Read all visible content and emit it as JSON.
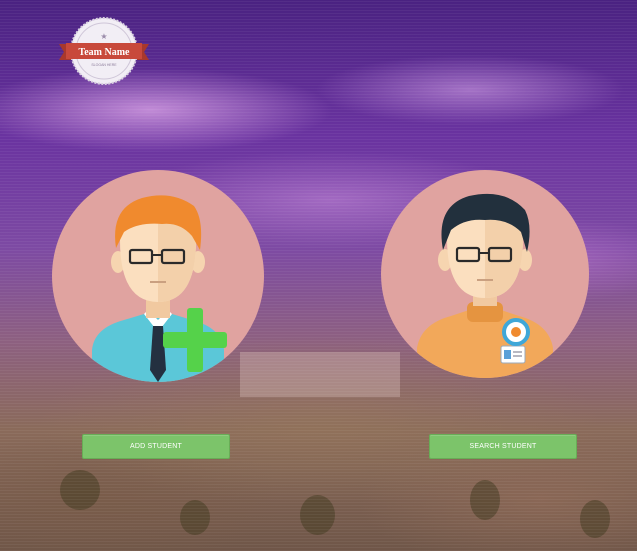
{
  "logo": {
    "title": "Team Name",
    "subtitle": "SLOGAN HERE"
  },
  "actions": {
    "add_student": {
      "label": "ADD STUDENT"
    },
    "search_student": {
      "label": "SEARCH STUDENT"
    }
  },
  "colors": {
    "button_green": "#7cc46a",
    "avatar_circle": "#e0a3a0",
    "plus_green": "#55d24a",
    "ribbon_red": "#c8493b"
  },
  "icons": {
    "add": "add-student-avatar-icon",
    "search": "search-student-avatar-icon",
    "plus": "plus-icon",
    "magnifier": "magnifier-icon",
    "id_card": "id-card-icon"
  }
}
